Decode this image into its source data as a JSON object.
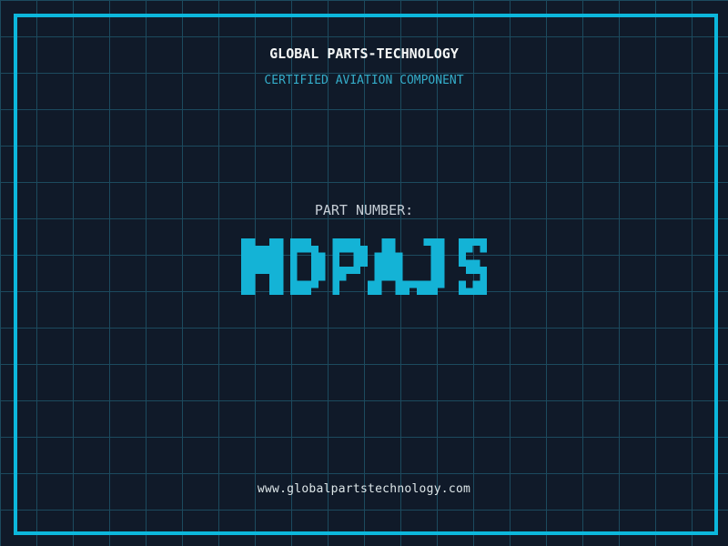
{
  "header": {
    "company_name": "GLOBAL PARTS-TECHNOLOGY",
    "certification_line": "CERTIFIED AVIATION COMPONENT"
  },
  "part": {
    "label": "PART NUMBER:",
    "number": "MDPAJS"
  },
  "footer": {
    "website": "www.globalpartstechnology.com"
  },
  "colors": {
    "background": "#101a29",
    "grid_line": "#1c4a5e",
    "frame_border": "#0cb7dc",
    "part_number": "#14b3d6",
    "subtitle_cyan": "#34adca",
    "title_text": "#f4f6f6",
    "label_text": "#c6ced6",
    "website_text": "#dde6e8"
  }
}
